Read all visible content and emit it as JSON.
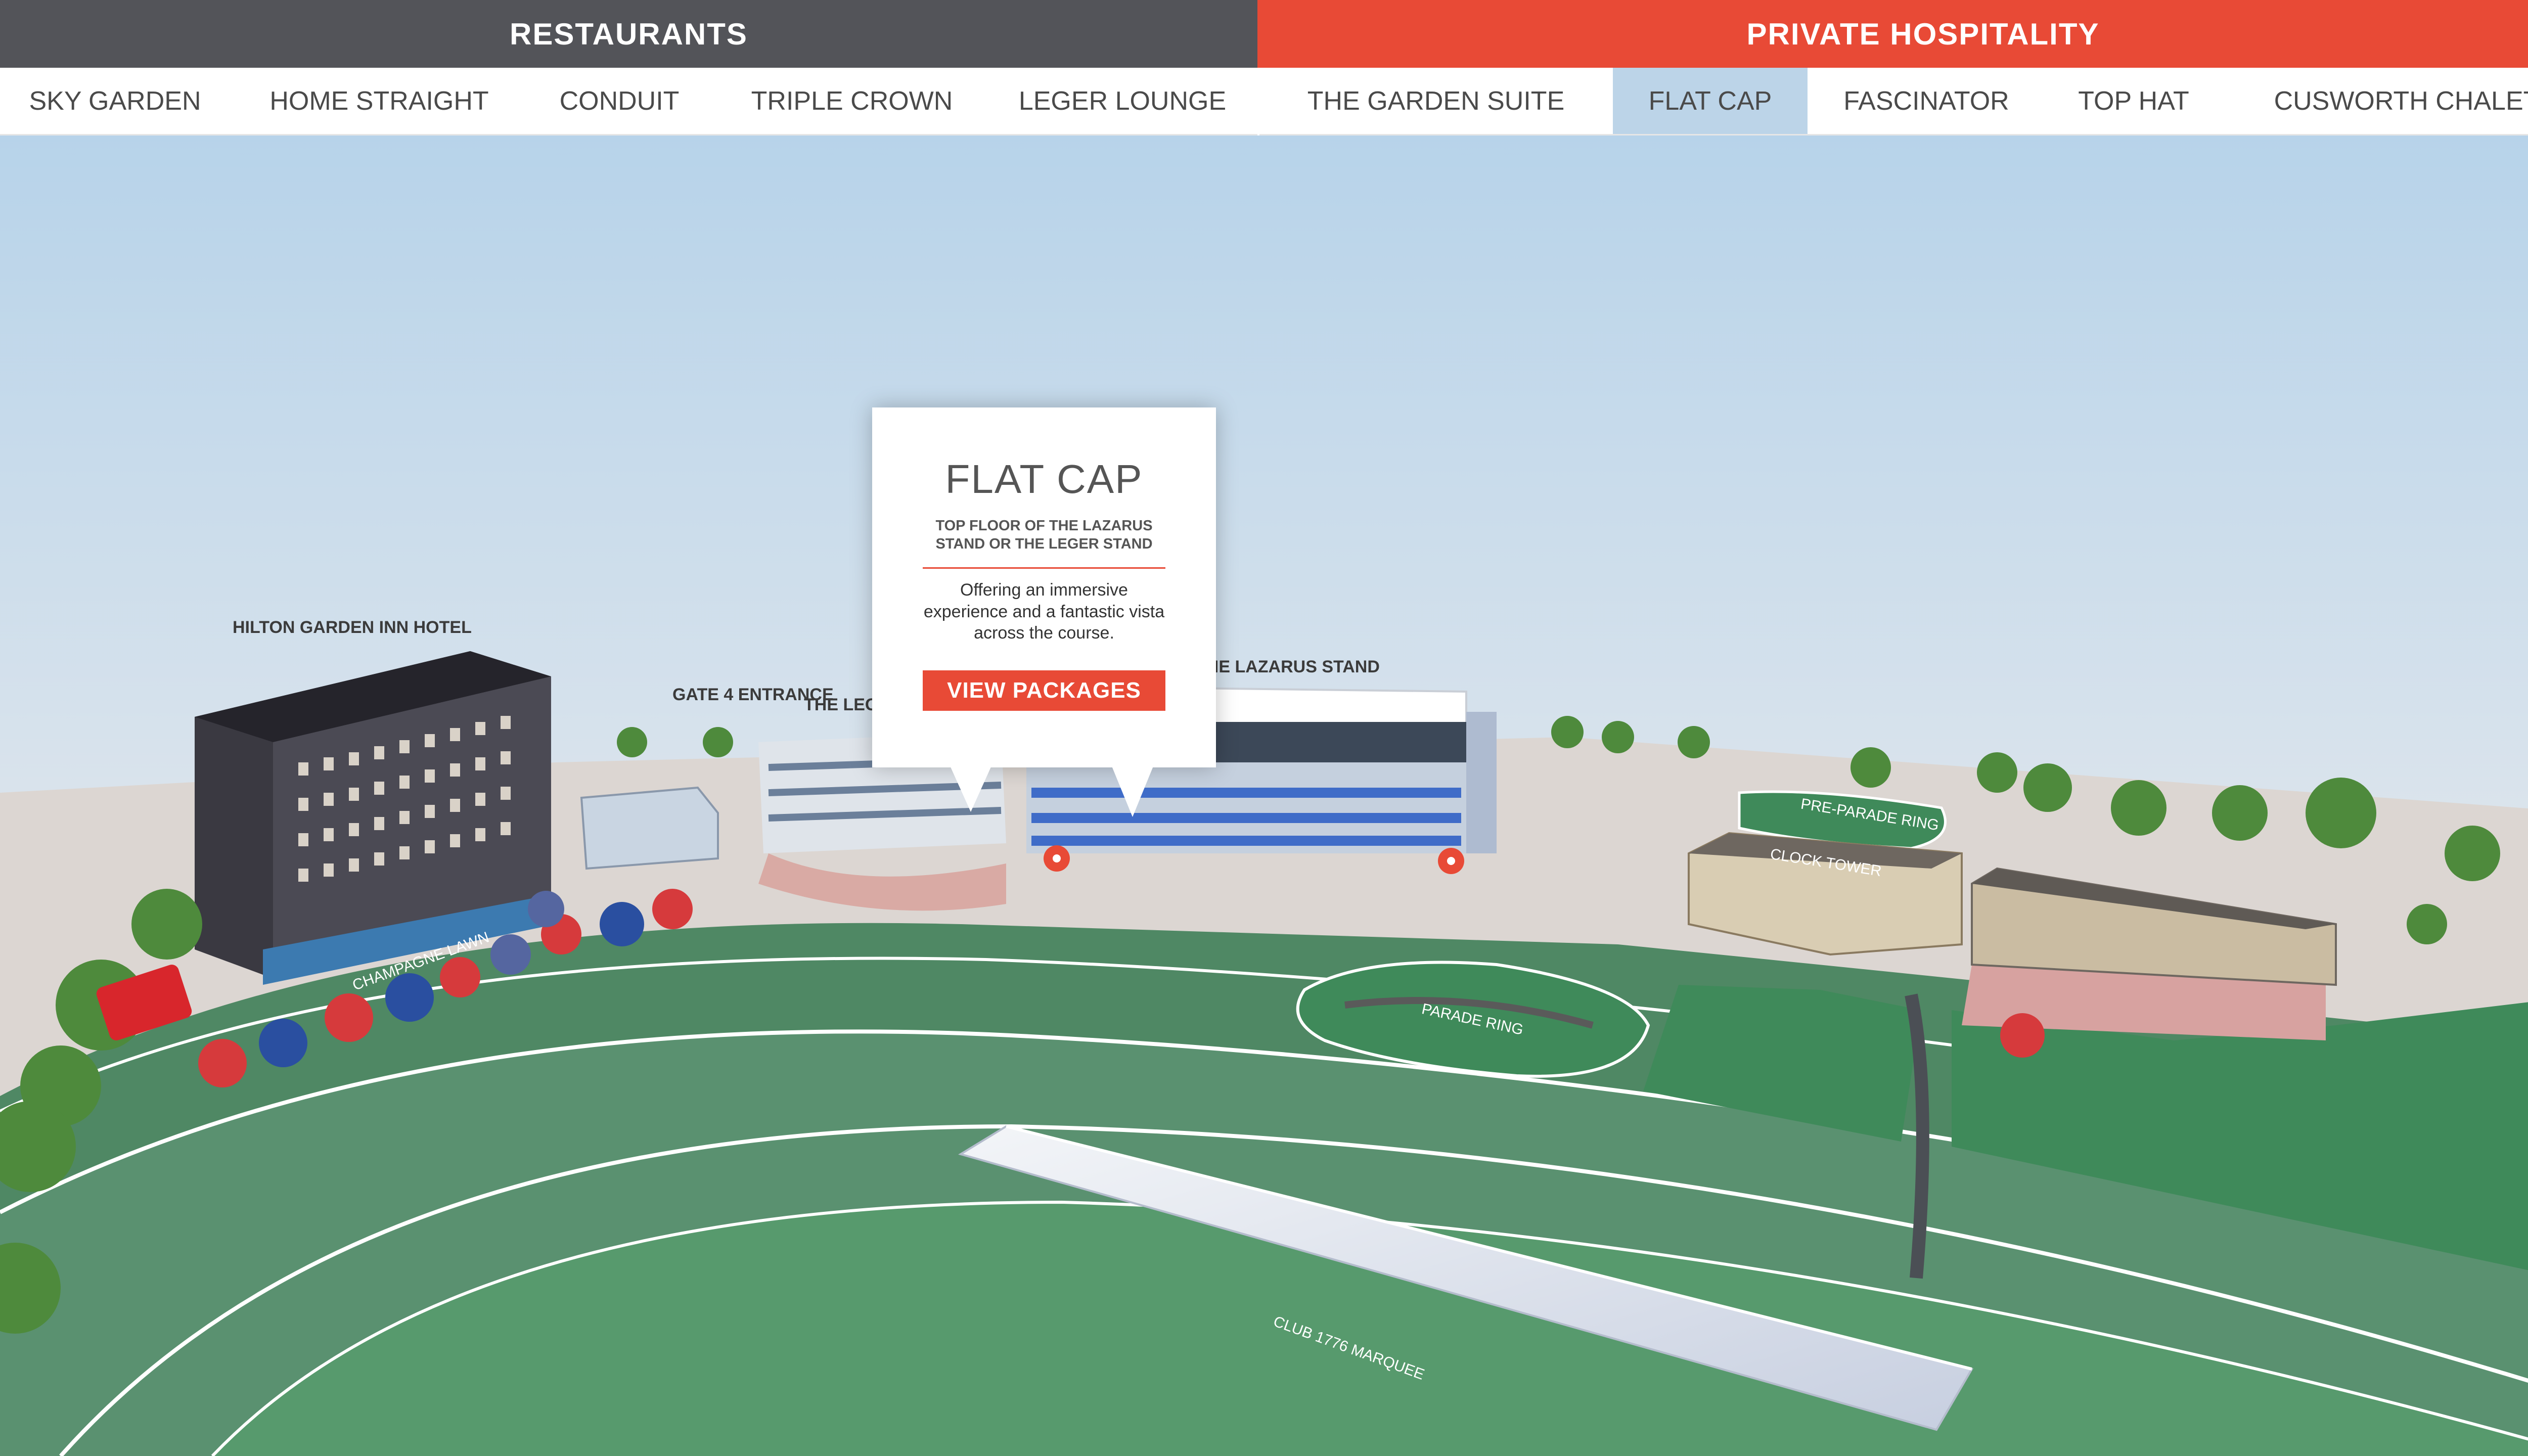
{
  "nav": {
    "categories": [
      {
        "label": "RESTAURANTS"
      },
      {
        "label": "PRIVATE HOSPITALITY"
      }
    ],
    "tabs": [
      {
        "label": "SKY GARDEN"
      },
      {
        "label": "HOME STRAIGHT"
      },
      {
        "label": "CONDUIT"
      },
      {
        "label": "TRIPLE CROWN"
      },
      {
        "label": "LEGER LOUNGE"
      },
      {
        "label": "THE GARDEN SUITE"
      },
      {
        "label": "FLAT CAP"
      },
      {
        "label": "FASCINATOR"
      },
      {
        "label": "TOP HAT"
      },
      {
        "label": "CUSWORTH CHALET"
      }
    ],
    "active_tab": "FLAT CAP"
  },
  "popup": {
    "title": "FLAT CAP",
    "subtitle": "TOP FLOOR OF THE LAZARUS STAND OR THE LEGER STAND",
    "body": "Offering an immersive experience and a fantastic vista across the course.",
    "button_label": "VIEW PACKAGES"
  },
  "map": {
    "labels": {
      "hilton": "HILTON GARDEN INN HOTEL",
      "gate4": "GATE 4 ENTRANCE",
      "leger_stand": "THE LEGER STAND",
      "lazarus_stand": "THE LAZARUS STAND",
      "champagne_lawn": "CHAMPAGNE LAWN",
      "pre_parade_ring": "PRE-PARADE RING",
      "clock_tower": "CLOCK TOWER",
      "parade_ring": "PARADE RING",
      "marquee": "CLUB 1776 MARQUEE"
    }
  },
  "colors": {
    "restaurants_bg": "#535459",
    "hospitality_bg": "#e84a36",
    "active_tab_bg": "#bcd4e8",
    "sky_top": "#b7d3ea",
    "sky_bottom": "#eceae8",
    "grass": "#5a9170",
    "accent": "#e84a36"
  }
}
